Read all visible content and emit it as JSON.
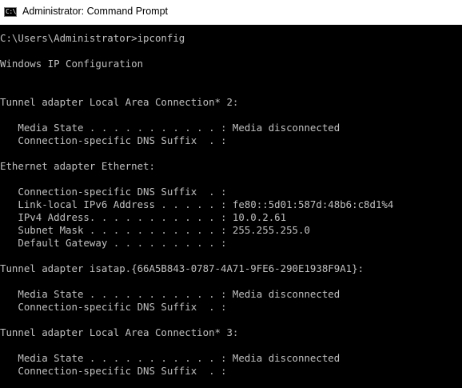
{
  "window": {
    "title": "Administrator: Command Prompt",
    "icon": "cmd-icon",
    "icon_glyph": "C:\\",
    "colors": {
      "titlebar_bg": "#ffffff",
      "console_bg": "#000000",
      "console_text": "#c0c0c0"
    }
  },
  "console": {
    "lines": [
      "C:\\Users\\Administrator>ipconfig",
      "",
      "Windows IP Configuration",
      "",
      "",
      "Tunnel adapter Local Area Connection* 2:",
      "",
      "   Media State . . . . . . . . . . . : Media disconnected",
      "   Connection-specific DNS Suffix  . :",
      "",
      "Ethernet adapter Ethernet:",
      "",
      "   Connection-specific DNS Suffix  . :",
      "   Link-local IPv6 Address . . . . . : fe80::5d01:587d:48b6:c8d1%4",
      "   IPv4 Address. . . . . . . . . . . : 10.0.2.61",
      "   Subnet Mask . . . . . . . . . . . : 255.255.255.0",
      "   Default Gateway . . . . . . . . . :",
      "",
      "Tunnel adapter isatap.{66A5B843-0787-4A71-9FE6-290E1938F9A1}:",
      "",
      "   Media State . . . . . . . . . . . : Media disconnected",
      "   Connection-specific DNS Suffix  . :",
      "",
      "Tunnel adapter Local Area Connection* 3:",
      "",
      "   Media State . . . . . . . . . . . : Media disconnected",
      "   Connection-specific DNS Suffix  . :"
    ]
  }
}
